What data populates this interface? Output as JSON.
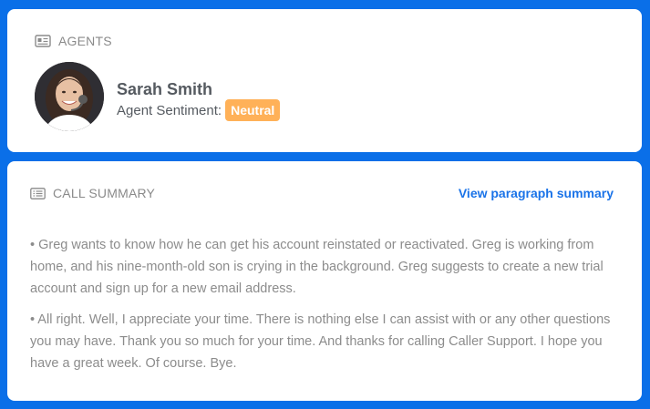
{
  "agents": {
    "header": "AGENTS",
    "agent": {
      "name": "Sarah Smith",
      "sentiment_label": "Agent Sentiment:",
      "sentiment_value": "Neutral",
      "sentiment_color": "#ffb158"
    }
  },
  "call_summary": {
    "header": "CALL SUMMARY",
    "view_link": "View paragraph summary",
    "items": [
      "• Greg wants to know how he can get his account reinstated or reactivated. Greg is working from home, and his nine-month-old son is crying in the background. Greg suggests to create a new trial account and sign up for a new email address.",
      "• All right. Well, I appreciate your time. There is nothing else I can assist with or any other questions you may have. Thank you so much for your time. And thanks for calling Caller Support. I hope you have a great week. Of course. Bye."
    ]
  },
  "colors": {
    "background": "#0a6fe8",
    "link": "#1a73e8",
    "badge": "#ffb158"
  },
  "icons": {
    "agents": "id-card-icon",
    "summary": "list-icon"
  }
}
